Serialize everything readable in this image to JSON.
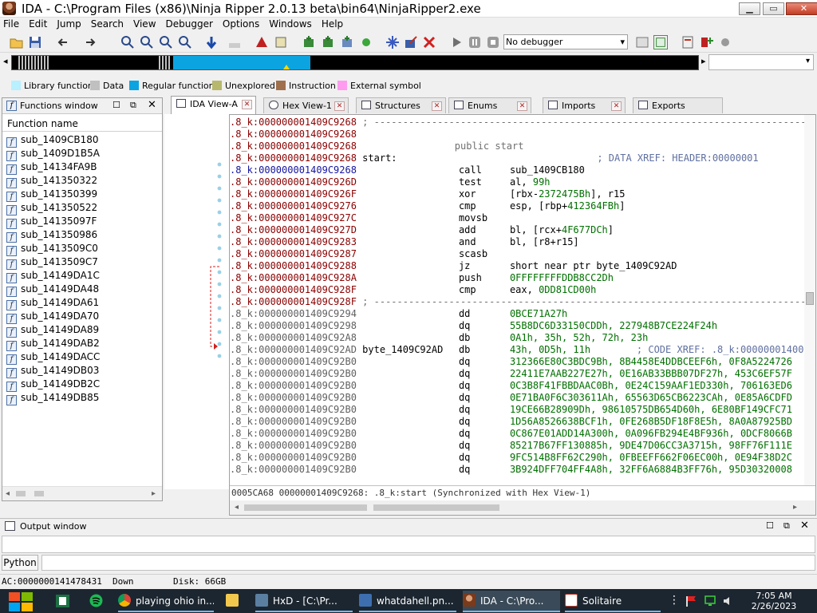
{
  "window": {
    "title": "IDA - C:\\Program Files (x86)\\Ninja Ripper 2.0.13 beta\\bin64\\NinjaRipper2.exe",
    "minimize_glyph": "▁",
    "maximize_glyph": "▭",
    "close_glyph": "✕"
  },
  "menu": [
    "File",
    "Edit",
    "Jump",
    "Search",
    "View",
    "Debugger",
    "Options",
    "Windows",
    "Help"
  ],
  "toolbar": {
    "debugger_select": "No debugger",
    "icons": [
      "open-file-icon",
      "save-icon",
      "back-icon",
      "forward-icon",
      "text-search-icon",
      "binary-search-icon",
      "imm-search-icon",
      "next-search-icon",
      "jump-icon",
      "flowchart-icon",
      "graph-icon",
      "add-func-icon",
      "add-struct-icon",
      "patch-icon",
      "delete-icon",
      "play-icon",
      "pause-icon",
      "stop-icon",
      "breakpoint-icon",
      "trace-icon",
      "options-icon",
      "settings-icon"
    ]
  },
  "legend": [
    {
      "label": "Library function",
      "color": "#b8f0ff"
    },
    {
      "label": "Data",
      "color": "#c0c0c0"
    },
    {
      "label": "Regular function",
      "color": "#0ca4e0"
    },
    {
      "label": "Unexplored",
      "color": "#b8b86c"
    },
    {
      "label": "Instruction",
      "color": "#a0704c"
    },
    {
      "label": "External symbol",
      "color": "#ff9cf0"
    }
  ],
  "functions_window": {
    "title": "Functions window",
    "column": "Function name",
    "items": [
      "sub_1409CB180",
      "sub_1409D1B5A",
      "sub_14134FA9B",
      "sub_141350322",
      "sub_141350399",
      "sub_141350522",
      "sub_14135097F",
      "sub_141350986",
      "sub_1413509C0",
      "sub_1413509C7",
      "sub_14149DA1C",
      "sub_14149DA48",
      "sub_14149DA61",
      "sub_14149DA70",
      "sub_14149DA89",
      "sub_14149DAB2",
      "sub_14149DACC",
      "sub_14149DB03",
      "sub_14149DB2C",
      "sub_14149DB85"
    ]
  },
  "tabs": [
    {
      "label": "IDA View-A",
      "active": true
    },
    {
      "label": "Hex View-1"
    },
    {
      "label": "Structures"
    },
    {
      "label": "Enums"
    },
    {
      "label": "Imports"
    },
    {
      "label": "Exports"
    }
  ],
  "disasm": [
    {
      "addr": ".8_k:000000001409C9268",
      "kind": "code",
      "rest": " ; ---------------------------------------------------------------------------"
    },
    {
      "addr": ".8_k:000000001409C9268",
      "kind": "code",
      "rest": ""
    },
    {
      "addr": ".8_k:000000001409C9268",
      "kind": "code",
      "rest": "                 public start"
    },
    {
      "addr": ".8_k:000000001409C9268",
      "kind": "code",
      "label": " start:",
      "rest": "                        ; DATA XREF: HEADER:00000001"
    },
    {
      "addr": ".8_k:000000001409C9268",
      "kind": "cur",
      "mn": "call",
      "op": "sub_1409CB180"
    },
    {
      "addr": ".8_k:000000001409C926D",
      "kind": "code",
      "mn": "test",
      "op": "al, ",
      "num": "99h"
    },
    {
      "addr": ".8_k:000000001409C926F",
      "kind": "code",
      "mn": "xor",
      "op": "[rbx-",
      "num": "2372475Bh",
      "op2": "], r15"
    },
    {
      "addr": ".8_k:000000001409C9276",
      "kind": "code",
      "mn": "cmp",
      "op": "esp, [rbp+",
      "num": "412364FBh",
      "op2": "]"
    },
    {
      "addr": ".8_k:000000001409C927C",
      "kind": "code",
      "mn": "movsb",
      "op": ""
    },
    {
      "addr": ".8_k:000000001409C927D",
      "kind": "code",
      "mn": "add",
      "op": "bl, [rcx+",
      "num": "4F677DCh",
      "op2": "]"
    },
    {
      "addr": ".8_k:000000001409C9283",
      "kind": "code",
      "mn": "and",
      "op": "bl, [r8+r15]"
    },
    {
      "addr": ".8_k:000000001409C9287",
      "kind": "code",
      "mn": "scasb",
      "op": ""
    },
    {
      "addr": ".8_k:000000001409C9288",
      "kind": "code",
      "mn": "jz",
      "op": "short near ptr byte_1409C92AD"
    },
    {
      "addr": ".8_k:000000001409C928A",
      "kind": "code",
      "mn": "push",
      "num": "0FFFFFFFFDDB8CC2Dh"
    },
    {
      "addr": ".8_k:000000001409C928F",
      "kind": "code",
      "mn": "cmp",
      "op": "eax, ",
      "num": "0DD81CD00h"
    },
    {
      "addr": ".8_k:000000001409C928F",
      "kind": "code",
      "rest": " ; ---------------------------------------------------------------------------"
    },
    {
      "addr": ".8_k:000000001409C9294",
      "kind": "data",
      "mn": "dd",
      "num": "0BCE71A27h"
    },
    {
      "addr": ".8_k:000000001409C9298",
      "kind": "data",
      "mn": "dq",
      "num": "55B8DC6D33150CDDh, 227948B7CE224F24h"
    },
    {
      "addr": ".8_k:000000001409C92A8",
      "kind": "data",
      "mn": "db",
      "num": "0A1h, 35h, 52h, 72h, 23h"
    },
    {
      "addr": ".8_k:000000001409C92AD",
      "kind": "data",
      "label": " byte_1409C92AD",
      "mn": "db",
      "num": "43h, 0D5h, 11h",
      "rest": "        ; CODE XREF: .8_k:00000001400"
    },
    {
      "addr": ".8_k:000000001409C92B0",
      "kind": "data",
      "mn": "dq",
      "num": "312366E80C3BDC9Bh, 8B4458E4DDBCEEF6h, 0F8A5224726"
    },
    {
      "addr": ".8_k:000000001409C92B0",
      "kind": "data",
      "mn": "dq",
      "num": "22411E7AAB227E27h, 0E16AB33BBB07DF27h, 453C6EF57F"
    },
    {
      "addr": ".8_k:000000001409C92B0",
      "kind": "data",
      "mn": "dq",
      "num": "0C3B8F41FBBDAAC0Bh, 0E24C159AAF1ED330h, 706163ED6"
    },
    {
      "addr": ".8_k:000000001409C92B0",
      "kind": "data",
      "mn": "dq",
      "num": "0E71BA0F6C303611Ah, 65563D65CB6223CAh, 0E85A6CDFD"
    },
    {
      "addr": ".8_k:000000001409C92B0",
      "kind": "data",
      "mn": "dq",
      "num": "19CE66B28909Dh, 98610575DB654D60h, 6E80BF149CFC71"
    },
    {
      "addr": ".8_k:000000001409C92B0",
      "kind": "data",
      "mn": "dq",
      "num": "1D56A8526638BCF1h, 0FE268B5DF18F8E5h, 8A0A87925BD"
    },
    {
      "addr": ".8_k:000000001409C92B0",
      "kind": "data",
      "mn": "dq",
      "num": "0C867E01ADD14A300h, 0A096FB294E4BF936h, 0DCF8066B"
    },
    {
      "addr": ".8_k:000000001409C92B0",
      "kind": "data",
      "mn": "dq",
      "num": "85217B67FF130885h, 9DE47D06CC3A3715h, 98FF76F111E"
    },
    {
      "addr": ".8_k:000000001409C92B0",
      "kind": "data",
      "mn": "dq",
      "num": "9FC514B8FF62C290h, 0FBEEFF662F06EC00h, 0E94F38D2C"
    },
    {
      "addr": ".8_k:000000001409C92B0",
      "kind": "data",
      "mn": "dq",
      "num": "3B924DFF704FF4A8h, 32FF6A6884B3FF76h, 95D30320008"
    }
  ],
  "disasm_status": "0005CA68 00000001409C9268: .8_k:start (Synchronized with Hex View-1)",
  "output_window": {
    "title": "Output window",
    "text": "--------------------------------------------------------------------------------------------------------------------------"
  },
  "python_button": "Python",
  "statusbar": {
    "ac": "AC:0000000141478431",
    "direction": "Down",
    "disk": "Disk: 66GB"
  },
  "taskbar": {
    "items": [
      {
        "label": "playing ohio in...",
        "icon_color": "#e8453c"
      },
      {
        "label": "",
        "icon_color": "#f2c94c"
      },
      {
        "label": "HxD - [C:\\Pr...",
        "icon_color": "#5a7fa0"
      },
      {
        "label": "whatdahell.pn...",
        "icon_color": "#3d6fb0"
      },
      {
        "label": "IDA - C:\\Pro...",
        "icon_color": "#8a4a2a"
      },
      {
        "label": "Solitaire",
        "icon_color": "#c0392b"
      }
    ],
    "time": "7:05 AM",
    "date": "2/26/2023"
  }
}
